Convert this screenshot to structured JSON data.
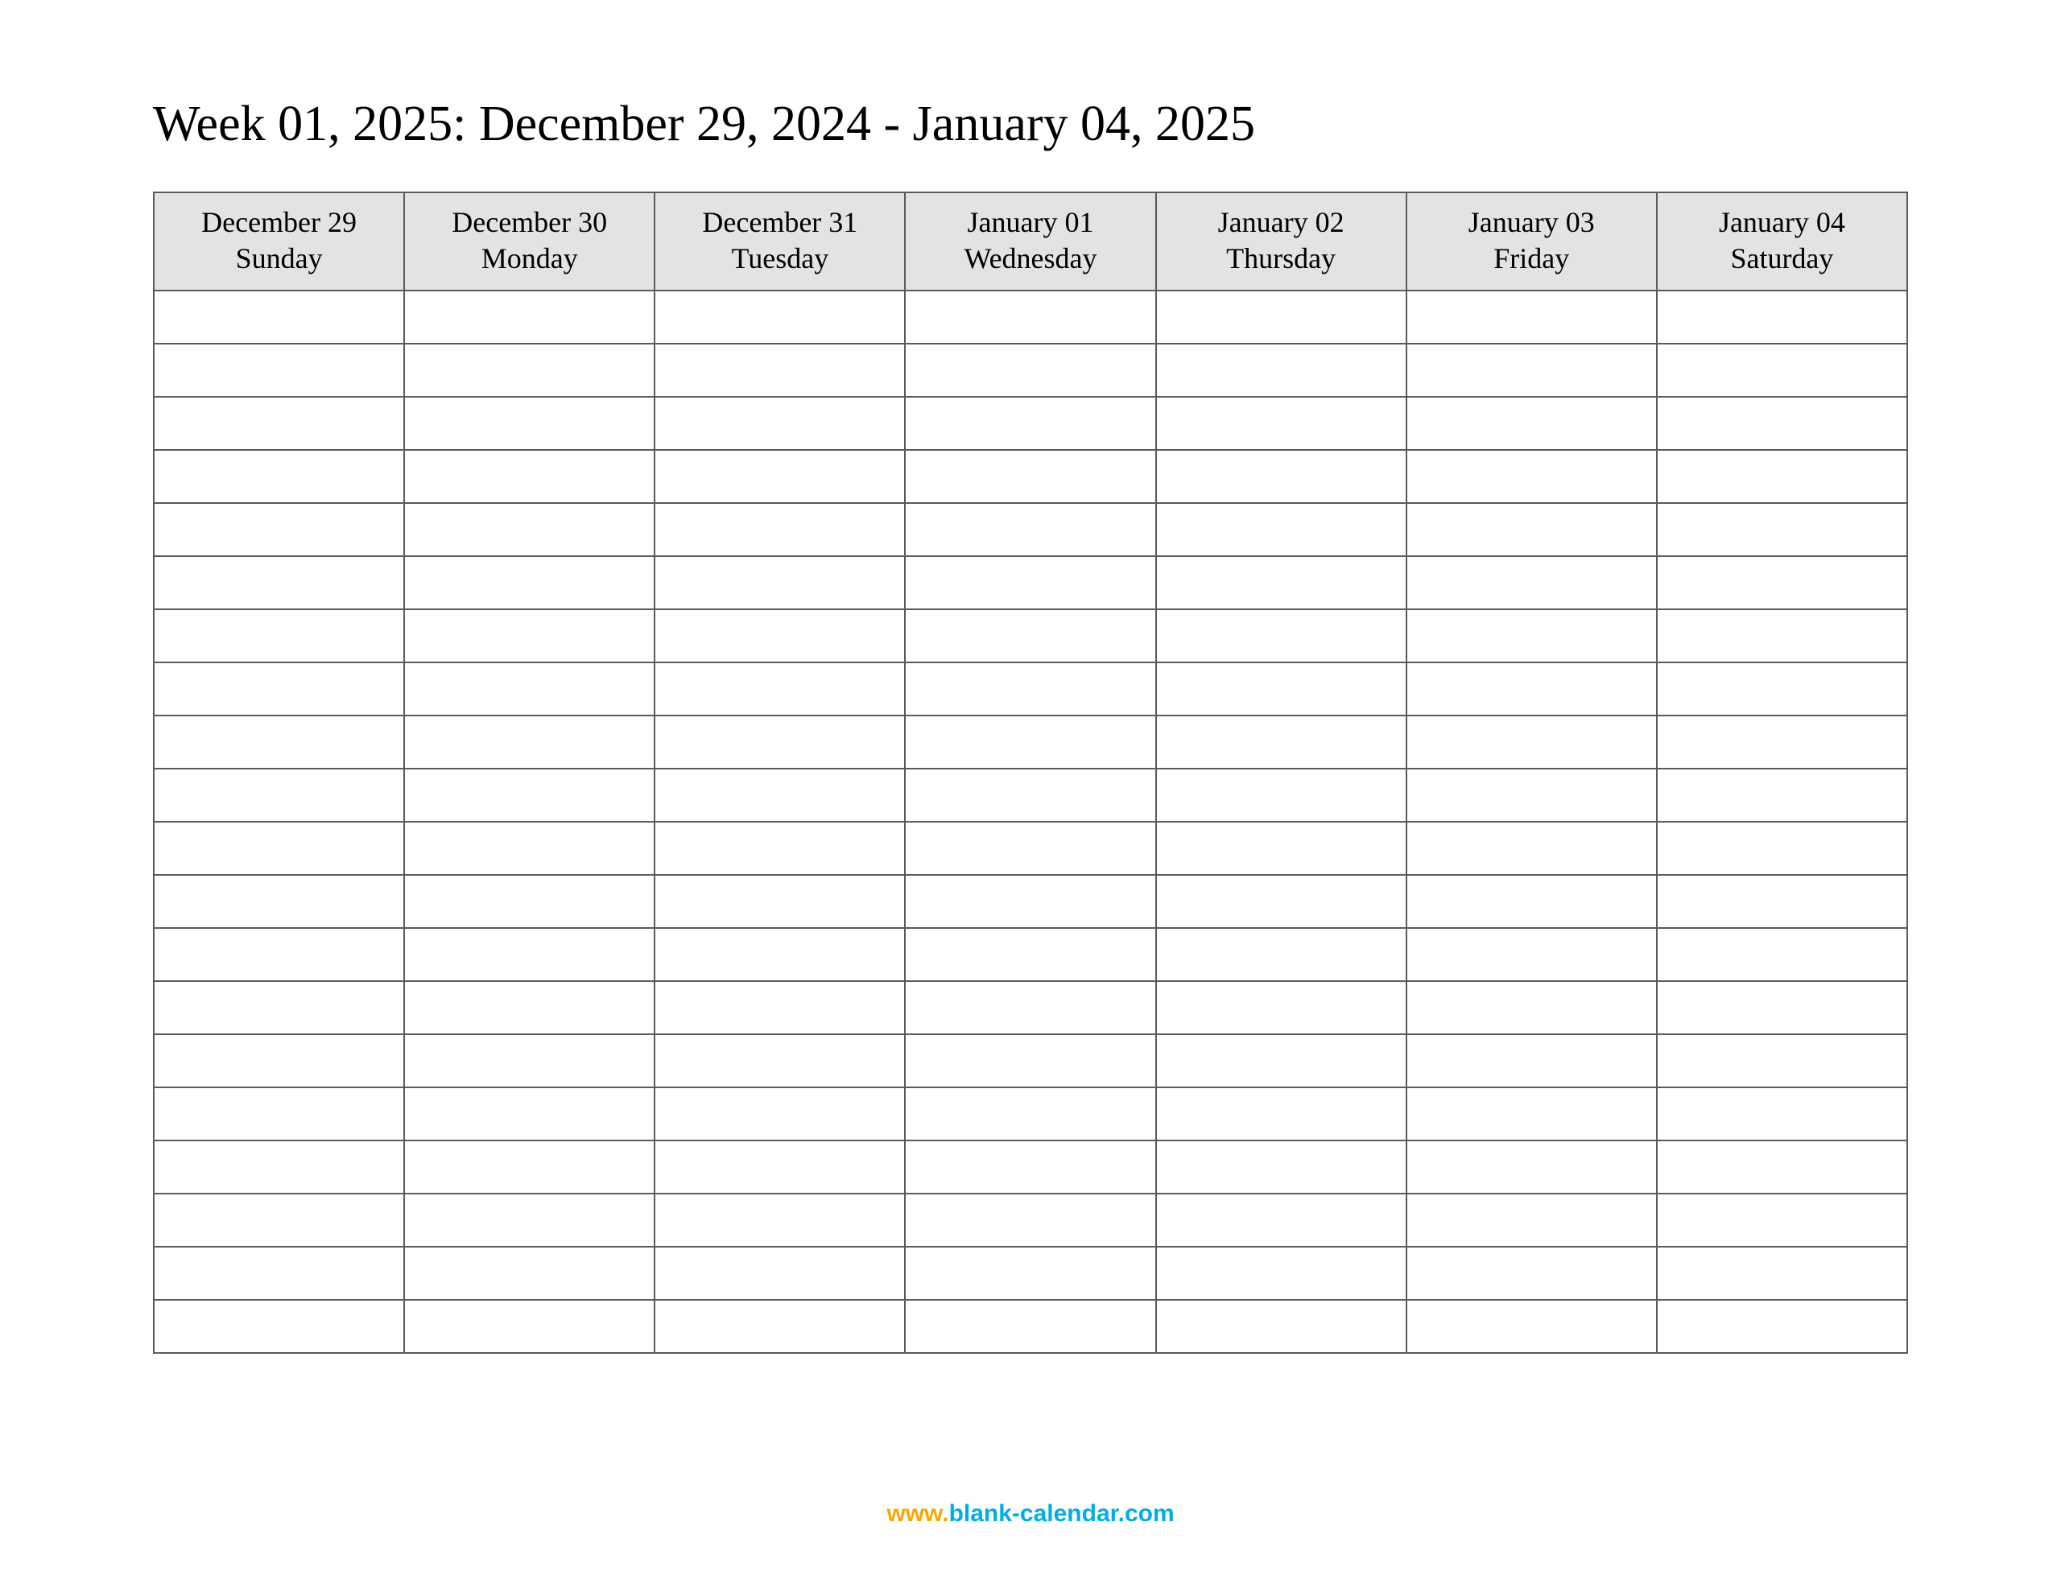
{
  "title": "Week 01, 2025: December 29, 2024 - January 04, 2025",
  "columns": [
    {
      "date": "December 29",
      "dow": "Sunday"
    },
    {
      "date": "December 30",
      "dow": "Monday"
    },
    {
      "date": "December 31",
      "dow": "Tuesday"
    },
    {
      "date": "January 01",
      "dow": "Wednesday"
    },
    {
      "date": "January 02",
      "dow": "Thursday"
    },
    {
      "date": "January 03",
      "dow": "Friday"
    },
    {
      "date": "January 04",
      "dow": "Saturday"
    }
  ],
  "row_count": 20,
  "footer": {
    "prefix": "www.",
    "domain": "blank-calendar.com"
  }
}
